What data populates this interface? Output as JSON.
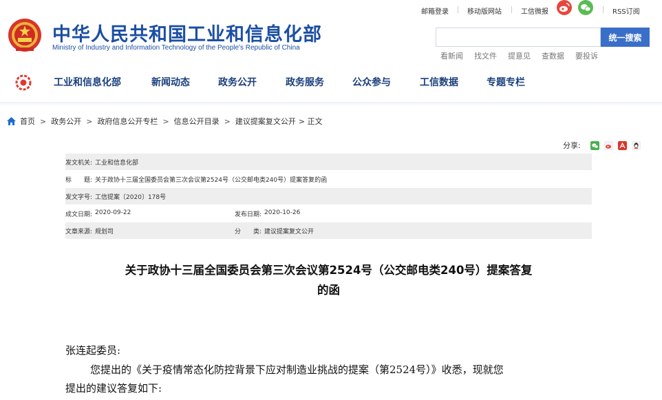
{
  "site": {
    "title": "中华人民共和国工业和信息化部",
    "subtitle": "Ministry of Industry and Information Technology of the People's Republic of China"
  },
  "top_links": {
    "mail_login": "邮箱登录",
    "mobile_site": "移动版网站",
    "weibo": "工信微报",
    "rss": "RSS订阅"
  },
  "search": {
    "placeholder": "",
    "button_label": "统一搜索",
    "quick_links": [
      "看新闻",
      "找文件",
      "提意见",
      "查数据",
      "要投诉"
    ]
  },
  "nav": {
    "items": [
      "工业和信息化部",
      "新闻动态",
      "政务公开",
      "政务服务",
      "公众参与",
      "工信数据",
      "专题专栏"
    ]
  },
  "breadcrumb": {
    "items": [
      "首页",
      "政务公开",
      "政府信息公开专栏",
      "信息公开目录",
      "建议提案复文公开"
    ],
    "separator": ">",
    "current": "> 正文"
  },
  "share": {
    "label": "分享:"
  },
  "doc_info": {
    "issuer_label": "发文机关:",
    "issuer": "工业和信息化部",
    "title_label": "标　　题:",
    "title": "关于政协十三届全国委员会第三次会议第2524号（公交邮电类240号）提案答复的函",
    "number_label": "发文字号:",
    "number": "工信提案〔2020〕178号",
    "created_label": "成文日期:",
    "created": "2020-09-22",
    "published_label": "发布日期:",
    "published": "2020-10-26",
    "source_label": "文章来源:",
    "source": "规划司",
    "category_label": "分　　类:",
    "category": "建议提案复文公开"
  },
  "article": {
    "title_line1": "关于政协十三届全国委员会第三次会议第2524号（公交邮电类240号）提案答复",
    "title_line2": "的函",
    "salutation": "张连起委员:",
    "para1_line1": "您提出的《关于疫情常态化防控背景下应对制造业挑战的提案（第2524号）》收悉，现就您",
    "para1_line2": "提出的建议答复如下:"
  },
  "colors": {
    "brand_blue": "#1b4fa3",
    "nav_blue": "#1a3f7c",
    "search_button": "#3a6fc9",
    "weibo_red": "#e8463c",
    "wechat_green": "#5bbb55",
    "row_gray": "#eeeeee"
  },
  "icons": {
    "emblem": "national-emblem-icon",
    "nav_logo": "miit-logo-icon",
    "home": "home-icon",
    "weibo": "weibo-icon",
    "wechat": "wechat-icon",
    "share": [
      "wechat-share-icon",
      "weibo-share-icon",
      "pdf-icon",
      "qq-icon"
    ]
  }
}
